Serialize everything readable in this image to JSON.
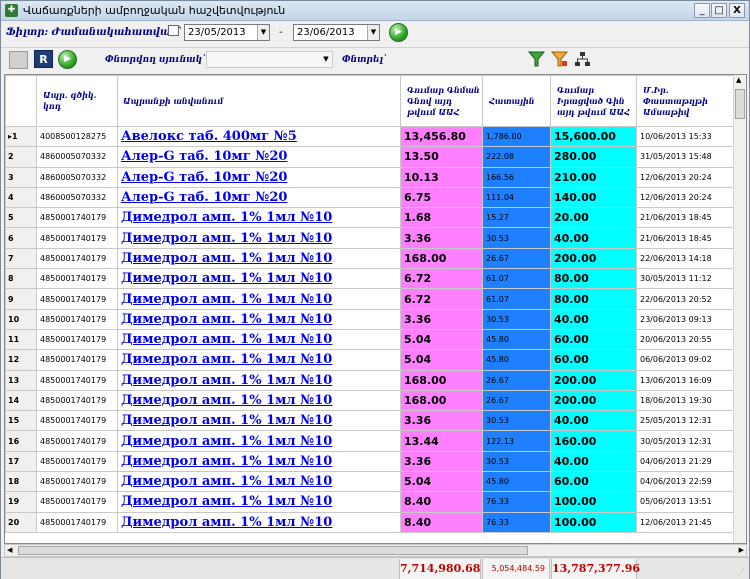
{
  "window": {
    "title": "Վաճառքների ամբողջական հաշվետվություն",
    "min_label": "_",
    "max_label": "□",
    "close_label": "X"
  },
  "filter": {
    "label": "Ֆիլտր: Ժամանակահատված`",
    "date_from": "23/05/2013",
    "date_to": "23/06/2013",
    "separator": "-",
    "checkbox_checked": false
  },
  "search": {
    "column_label": "Փնտրվող սյունակ`",
    "column_value": "",
    "search_label": "Փնտրել`",
    "search_value": ""
  },
  "colors": {
    "buy_price": "#ff80ff",
    "quantity": "#1e7fff",
    "sell_price": "#00ffff",
    "totals": "#c00000",
    "link": "#0000ee",
    "header": "#000080"
  },
  "icons": [
    "export-icon",
    "report-icon",
    "refresh-go-icon",
    "filter-green-icon",
    "filter-orange-icon",
    "hierarchy-icon"
  ],
  "table": {
    "headers": {
      "barcode": "Ապր. գծիկ. կոդ",
      "name": "Ապրանքի անվանում",
      "buy_price": "Գումար Գնման Գնով այդ թվում ԱԱՀ",
      "quantity": "Հատային",
      "sell_price": "Գումար Իրացված Գին այդ թվում ԱԱՀ",
      "date": "Մ.Իր. Փաստաթղթի Ամսաթիվ"
    },
    "rows": [
      {
        "idx": "1",
        "barcode": "4008500128275",
        "name": "Авелокс таб. 400мг №5",
        "buy_price": "13,456.80",
        "quantity": "1,786.00",
        "sell_price": "15,600.00",
        "date": "10/06/2013 15:33"
      },
      {
        "idx": "2",
        "barcode": "4860005070332",
        "name": "Алер-G таб. 10мг №20",
        "buy_price": "13.50",
        "quantity": "222.08",
        "sell_price": "280.00",
        "date": "31/05/2013 15:48"
      },
      {
        "idx": "3",
        "barcode": "4860005070332",
        "name": "Алер-G таб. 10мг №20",
        "buy_price": "10.13",
        "quantity": "166.56",
        "sell_price": "210.00",
        "date": "12/06/2013 20:24"
      },
      {
        "idx": "4",
        "barcode": "4860005070332",
        "name": "Алер-G таб. 10мг №20",
        "buy_price": "6.75",
        "quantity": "111.04",
        "sell_price": "140.00",
        "date": "12/06/2013 20:24"
      },
      {
        "idx": "5",
        "barcode": "4850001740179",
        "name": "Димедрол амп. 1% 1мл №10",
        "buy_price": "1.68",
        "quantity": "15.27",
        "sell_price": "20.00",
        "date": "21/06/2013 18:45"
      },
      {
        "idx": "6",
        "barcode": "4850001740179",
        "name": "Димедрол амп. 1% 1мл №10",
        "buy_price": "3.36",
        "quantity": "30.53",
        "sell_price": "40.00",
        "date": "21/06/2013 18:45"
      },
      {
        "idx": "7",
        "barcode": "4850001740179",
        "name": "Димедрол амп. 1% 1мл №10",
        "buy_price": "168.00",
        "quantity": "26.67",
        "sell_price": "200.00",
        "date": "22/06/2013 14:18"
      },
      {
        "idx": "8",
        "barcode": "4850001740179",
        "name": "Димедрол амп. 1% 1мл №10",
        "buy_price": "6.72",
        "quantity": "61.07",
        "sell_price": "80.00",
        "date": "30/05/2013 11:12"
      },
      {
        "idx": "9",
        "barcode": "4850001740179",
        "name": "Димедрол амп. 1% 1мл №10",
        "buy_price": "6.72",
        "quantity": "61.07",
        "sell_price": "80.00",
        "date": "22/06/2013 20:52"
      },
      {
        "idx": "10",
        "barcode": "4850001740179",
        "name": "Димедрол амп. 1% 1мл №10",
        "buy_price": "3.36",
        "quantity": "30.53",
        "sell_price": "40.00",
        "date": "23/06/2013 09:13"
      },
      {
        "idx": "11",
        "barcode": "4850001740179",
        "name": "Димедрол амп. 1% 1мл №10",
        "buy_price": "5.04",
        "quantity": "45.80",
        "sell_price": "60.00",
        "date": "20/06/2013 20:55"
      },
      {
        "idx": "12",
        "barcode": "4850001740179",
        "name": "Димедрол амп. 1% 1мл №10",
        "buy_price": "5.04",
        "quantity": "45.80",
        "sell_price": "60.00",
        "date": "06/06/2013 09:02"
      },
      {
        "idx": "13",
        "barcode": "4850001740179",
        "name": "Димедрол амп. 1% 1мл №10",
        "buy_price": "168.00",
        "quantity": "26.67",
        "sell_price": "200.00",
        "date": "13/06/2013 16:09"
      },
      {
        "idx": "14",
        "barcode": "4850001740179",
        "name": "Димедрол амп. 1% 1мл №10",
        "buy_price": "168.00",
        "quantity": "26.67",
        "sell_price": "200.00",
        "date": "18/06/2013 19:30"
      },
      {
        "idx": "15",
        "barcode": "4850001740179",
        "name": "Димедрол амп. 1% 1мл №10",
        "buy_price": "3.36",
        "quantity": "30.53",
        "sell_price": "40.00",
        "date": "25/05/2013 12:31"
      },
      {
        "idx": "16",
        "barcode": "4850001740179",
        "name": "Димедрол амп. 1% 1мл №10",
        "buy_price": "13.44",
        "quantity": "122.13",
        "sell_price": "160.00",
        "date": "30/05/2013 12:31"
      },
      {
        "idx": "17",
        "barcode": "4850001740179",
        "name": "Димедрол амп. 1% 1мл №10",
        "buy_price": "3.36",
        "quantity": "30.53",
        "sell_price": "40.00",
        "date": "04/06/2013 21:29"
      },
      {
        "idx": "18",
        "barcode": "4850001740179",
        "name": "Димедрол амп. 1% 1мл №10",
        "buy_price": "5.04",
        "quantity": "45.80",
        "sell_price": "60.00",
        "date": "04/06/2013 22:59"
      },
      {
        "idx": "19",
        "barcode": "4850001740179",
        "name": "Димедрол амп. 1% 1мл №10",
        "buy_price": "8.40",
        "quantity": "76.33",
        "sell_price": "100.00",
        "date": "05/06/2013 13:51"
      },
      {
        "idx": "20",
        "barcode": "4850001740179",
        "name": "Димедрол амп. 1% 1мл №10",
        "buy_price": "8.40",
        "quantity": "76.33",
        "sell_price": "100.00",
        "date": "12/06/2013 21:45"
      }
    ]
  },
  "totals": {
    "buy_price": "7,714,980.68",
    "quantity": "5,054,484.59",
    "sell_price": "13,787,377.96"
  }
}
